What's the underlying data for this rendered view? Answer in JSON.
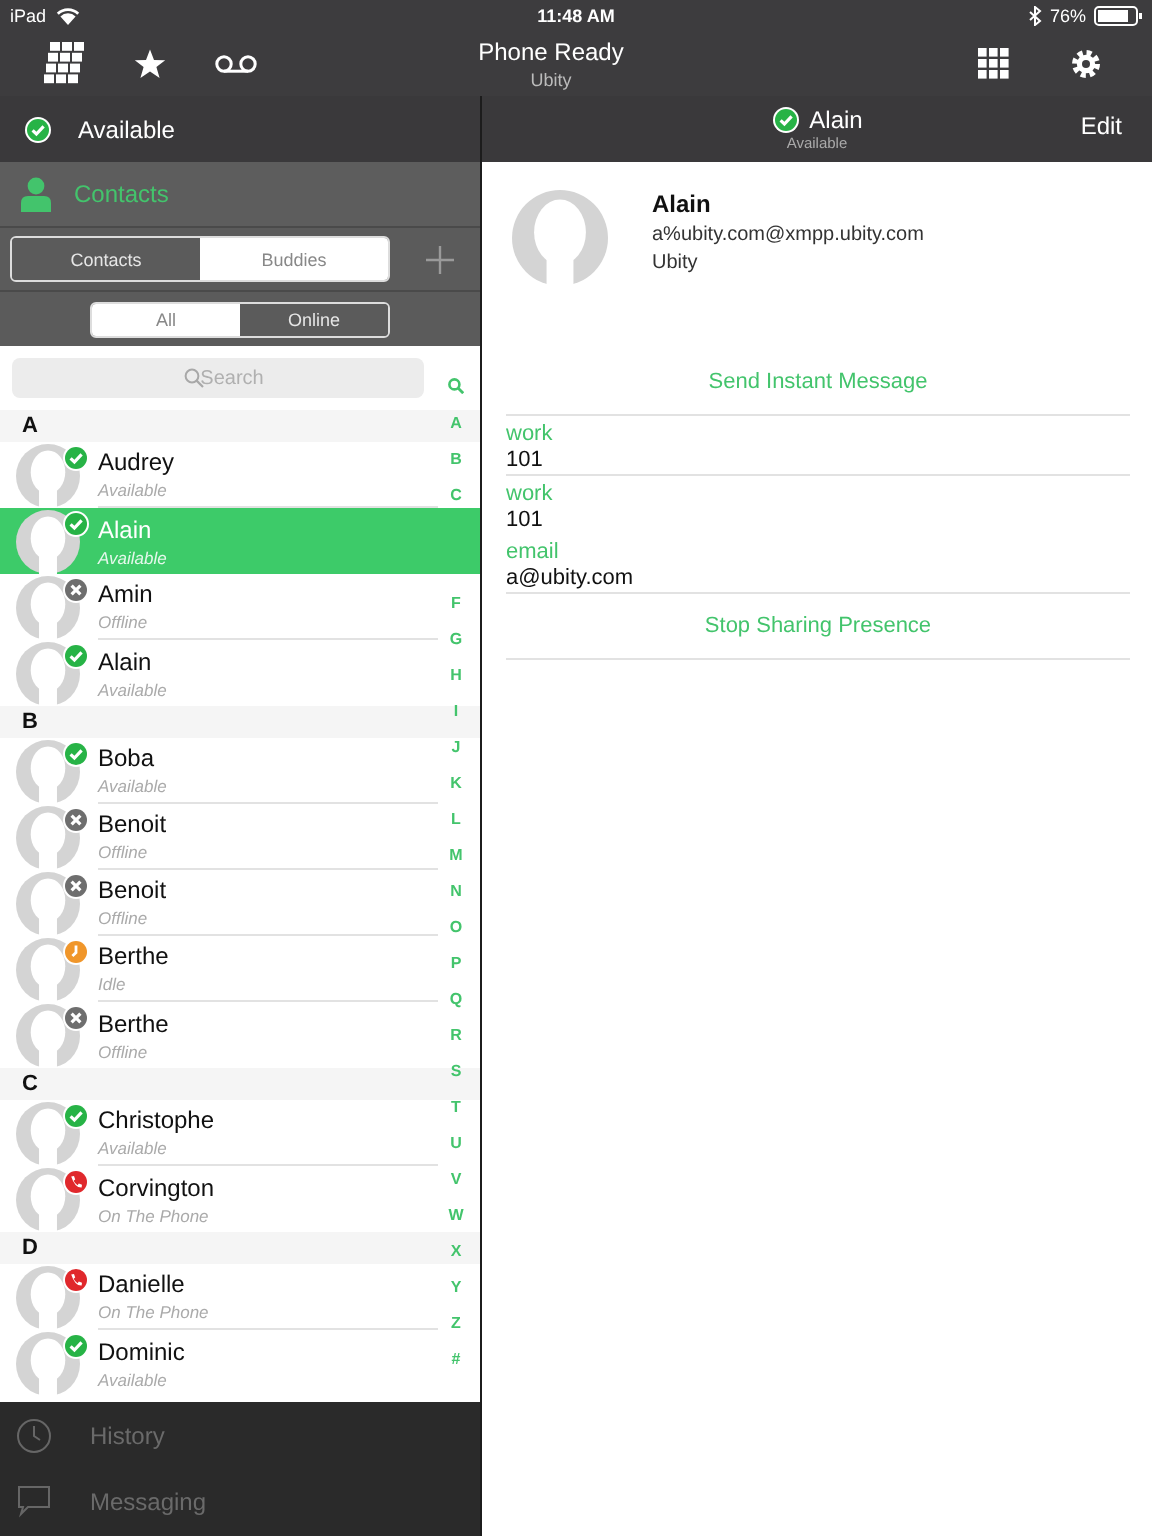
{
  "status_bar": {
    "carrier": "iPad",
    "time": "11:48 AM",
    "battery": "76%"
  },
  "toolbar": {
    "title": "Phone Ready",
    "subtitle": "Ubity"
  },
  "presence": {
    "label": "Available",
    "kind": "available"
  },
  "sidebar": {
    "section": "Contacts",
    "segments": [
      {
        "label": "Contacts",
        "selected": false
      },
      {
        "label": "Buddies",
        "selected": true
      }
    ],
    "filters": [
      {
        "label": "All",
        "selected": true
      },
      {
        "label": "Online",
        "selected": false
      }
    ],
    "search": {
      "placeholder": "Search"
    },
    "groups": [
      {
        "letter": "A",
        "contacts": [
          {
            "name": "Audrey",
            "status_text": "Available",
            "kind": "available",
            "selected": false
          },
          {
            "name": "Alain",
            "status_text": "Available",
            "kind": "available",
            "selected": true
          },
          {
            "name": "Amin",
            "status_text": "Offline",
            "kind": "offline",
            "selected": false
          },
          {
            "name": "Alain",
            "status_text": "Available",
            "kind": "available",
            "selected": false
          }
        ]
      },
      {
        "letter": "B",
        "contacts": [
          {
            "name": "Boba",
            "status_text": "Available",
            "kind": "available",
            "selected": false
          },
          {
            "name": "Benoit",
            "status_text": "Offline",
            "kind": "offline",
            "selected": false
          },
          {
            "name": "Benoit",
            "status_text": "Offline",
            "kind": "offline",
            "selected": false
          },
          {
            "name": "Berthe",
            "status_text": "Idle",
            "kind": "idle",
            "selected": false
          },
          {
            "name": "Berthe",
            "status_text": "Offline",
            "kind": "offline",
            "selected": false
          }
        ]
      },
      {
        "letter": "C",
        "contacts": [
          {
            "name": "Christophe",
            "status_text": "Available",
            "kind": "available",
            "selected": false
          },
          {
            "name": "Corvington",
            "status_text": "On The Phone",
            "kind": "phone",
            "selected": false
          }
        ]
      },
      {
        "letter": "D",
        "contacts": [
          {
            "name": "Danielle",
            "status_text": "On The Phone",
            "kind": "phone",
            "selected": false
          },
          {
            "name": "Dominic",
            "status_text": "Available",
            "kind": "available",
            "selected": false
          }
        ]
      }
    ],
    "index": [
      "A",
      "B",
      "C",
      "F",
      "G",
      "H",
      "I",
      "J",
      "K",
      "L",
      "M",
      "N",
      "O",
      "P",
      "Q",
      "R",
      "S",
      "T",
      "U",
      "V",
      "W",
      "X",
      "Y",
      "Z",
      "#"
    ],
    "nav": [
      {
        "label": "History",
        "kind": "history"
      },
      {
        "label": "Messaging",
        "kind": "messaging"
      }
    ]
  },
  "detail": {
    "header": {
      "name": "Alain",
      "status_text": "Available",
      "kind": "available"
    },
    "edit": "Edit",
    "contact": {
      "name": "Alain",
      "address": "a%ubity.com@xmpp.ubity.com",
      "company": "Ubity"
    },
    "items": [
      {
        "kind": "action",
        "label": "Send Instant Message"
      },
      {
        "kind": "field",
        "label": "work",
        "value": "101"
      },
      {
        "kind": "field",
        "label": "work",
        "value": "101"
      },
      {
        "kind": "field",
        "label": "email",
        "value": "a@ubity.com"
      },
      {
        "kind": "action",
        "label": "Stop Sharing Presence"
      }
    ]
  }
}
